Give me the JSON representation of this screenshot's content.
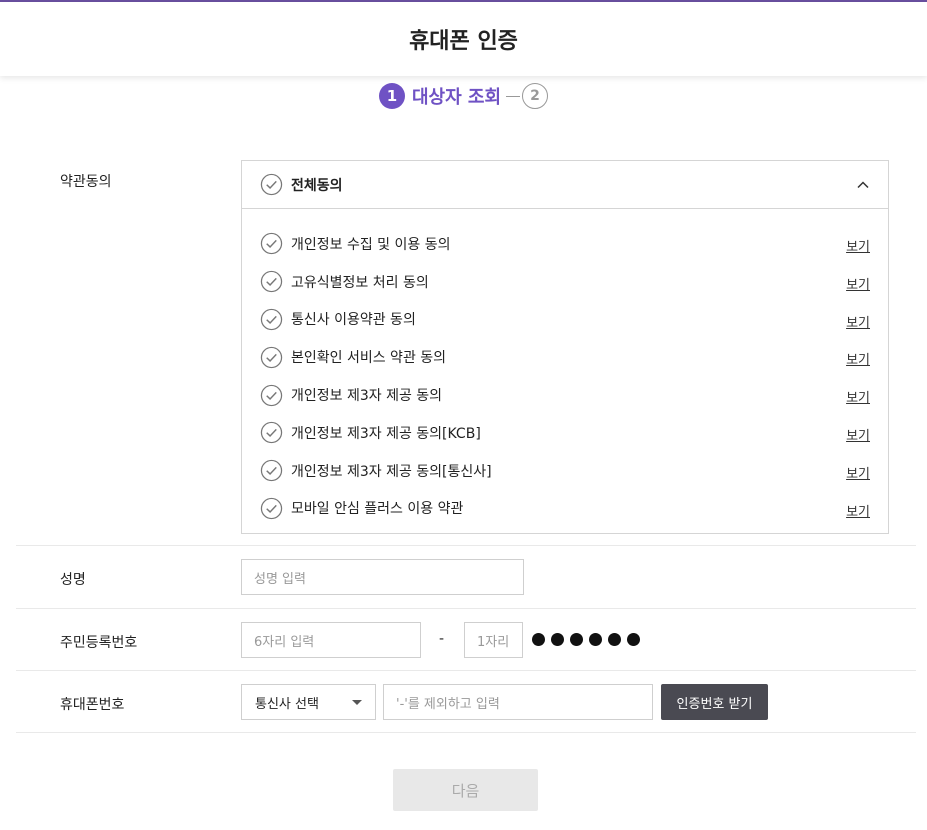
{
  "header": {
    "title": "휴대폰 인증"
  },
  "stepper": {
    "step1_num": "1",
    "step1_label": "대상자 조회",
    "step2_num": "2"
  },
  "terms": {
    "label": "약관동의",
    "all_agree": "전체동의",
    "view_label": "보기",
    "items": [
      {
        "label": "개인정보 수집 및 이용 동의"
      },
      {
        "label": "고유식별정보 처리 동의"
      },
      {
        "label": "통신사 이용약관 동의"
      },
      {
        "label": "본인확인 서비스 약관 동의"
      },
      {
        "label": "개인정보 제3자 제공 동의"
      },
      {
        "label": "개인정보 제3자 제공 동의[KCB]"
      },
      {
        "label": "개인정보 제3자 제공 동의[통신사]"
      },
      {
        "label": "모바일 안심 플러스 이용 약관"
      }
    ]
  },
  "name": {
    "label": "성명",
    "placeholder": "성명 입력"
  },
  "rrn": {
    "label": "주민등록번호",
    "front_placeholder": "6자리 입력",
    "separator": "-",
    "back_placeholder": "1자리",
    "masked_digits": 6
  },
  "phone": {
    "label": "휴대폰번호",
    "carrier_selected": "통신사 선택",
    "number_placeholder": "'-'를 제외하고 입력",
    "request_button": "인증번호 받기"
  },
  "next_button": "다음",
  "colors": {
    "accent": "#6f52c4",
    "top_border": "#6a4fa0",
    "dark_button": "#4a4a52",
    "disabled_button": "#e8e8e8"
  },
  "icons": {
    "check": "check-circle-icon",
    "collapse": "chevron-up-icon",
    "dropdown": "caret-down-icon"
  }
}
